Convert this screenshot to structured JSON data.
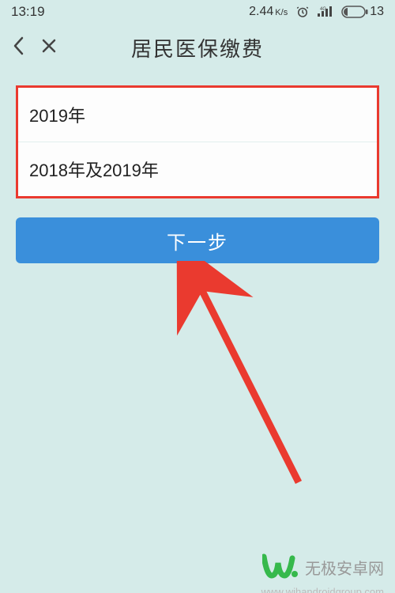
{
  "status_bar": {
    "time": "13:19",
    "net_speed_value": "2.44",
    "net_speed_unit": "K/s",
    "battery_percent": "13"
  },
  "nav": {
    "title": "居民医保缴费"
  },
  "year_options": {
    "items": [
      {
        "label": "2019年"
      },
      {
        "label": "2018年及2019年"
      }
    ]
  },
  "actions": {
    "next_label": "下一步"
  },
  "annotation": {
    "arrow_target": "next-step-button",
    "highlight_box": "year-options"
  },
  "watermark": {
    "brand": "无极安卓网",
    "url": "www.wjhandroidgroup.com"
  }
}
